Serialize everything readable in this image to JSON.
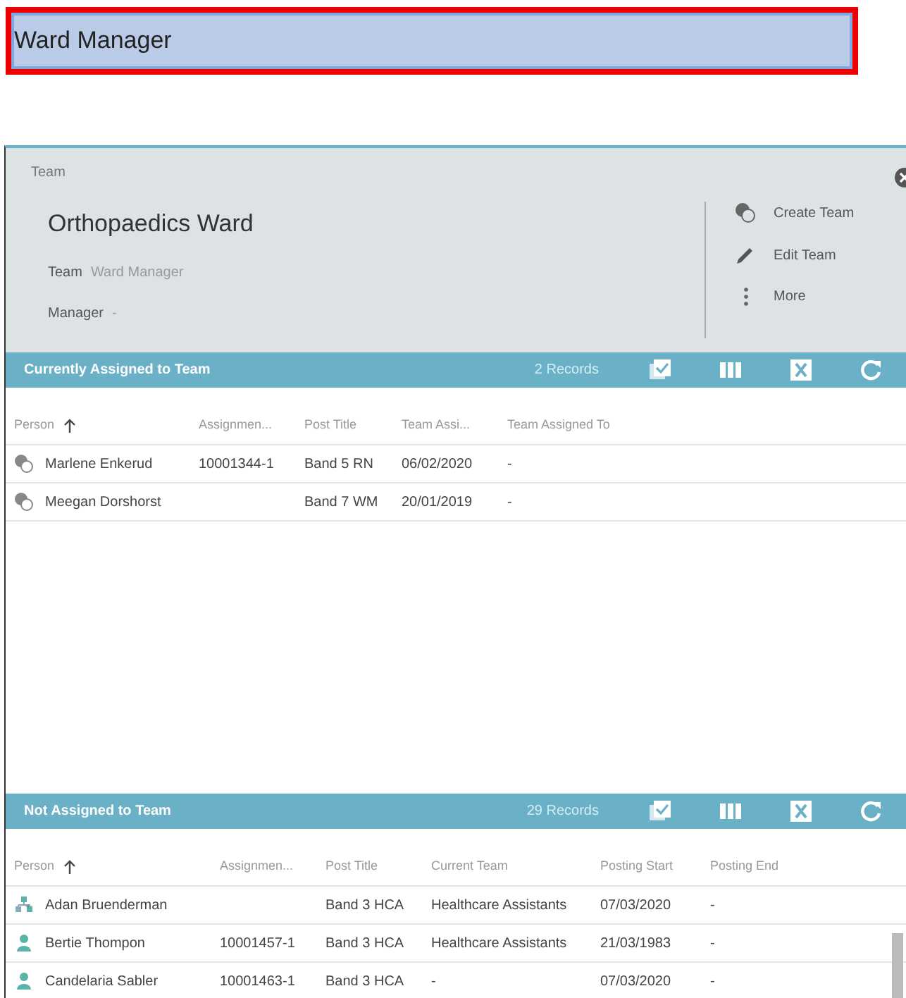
{
  "banner": {
    "title": "Ward Manager"
  },
  "team": {
    "caption": "Team",
    "name": "Orthopaedics Ward",
    "fields": [
      {
        "label": "Team",
        "value": "Ward Manager"
      },
      {
        "label": "Manager",
        "value": "-"
      }
    ],
    "actions": [
      {
        "kind": "create",
        "label": "Create Team"
      },
      {
        "kind": "edit",
        "label": "Edit Team"
      },
      {
        "kind": "more",
        "label": "More"
      }
    ]
  },
  "sections": [
    {
      "title": "Currently Assigned to Team",
      "records": "2 Records",
      "columns": [
        {
          "label": "Person",
          "sorted": true
        },
        {
          "label": "Assignmen...",
          "sorted": false
        },
        {
          "label": "Post Title",
          "sorted": false
        },
        {
          "label": "Team Assi...",
          "sorted": false
        },
        {
          "label": "Team Assigned To",
          "sorted": false
        }
      ],
      "rows": [
        {
          "kind": "team",
          "cells": [
            "Marlene Enkerud",
            "10001344-1",
            "Band 5 RN",
            "06/02/2020",
            "-"
          ]
        },
        {
          "kind": "team",
          "cells": [
            "Meegan Dorshorst",
            "",
            "Band 7 WM",
            "20/01/2019",
            "-"
          ]
        }
      ]
    },
    {
      "title": "Not Assigned to Team",
      "records": "29 Records",
      "columns": [
        {
          "label": "Person",
          "sorted": true
        },
        {
          "label": "Assignmen...",
          "sorted": false
        },
        {
          "label": "Post Title",
          "sorted": false
        },
        {
          "label": "Current Team",
          "sorted": false
        },
        {
          "label": "Posting Start",
          "sorted": false
        },
        {
          "label": "Posting End",
          "sorted": false
        }
      ],
      "rows": [
        {
          "kind": "org",
          "cells": [
            "Adan Bruenderman",
            "",
            "Band 3 HCA",
            "Healthcare Assistants",
            "07/03/2020",
            "-"
          ]
        },
        {
          "kind": "person",
          "cells": [
            "Bertie Thompon",
            "10001457-1",
            "Band 3 HCA",
            "Healthcare Assistants",
            "21/03/1983",
            "-"
          ]
        },
        {
          "kind": "person",
          "cells": [
            "Candelaria Sabler",
            "10001463-1",
            "Band 3 HCA",
            "-",
            "07/03/2020",
            "-"
          ]
        }
      ]
    }
  ]
}
